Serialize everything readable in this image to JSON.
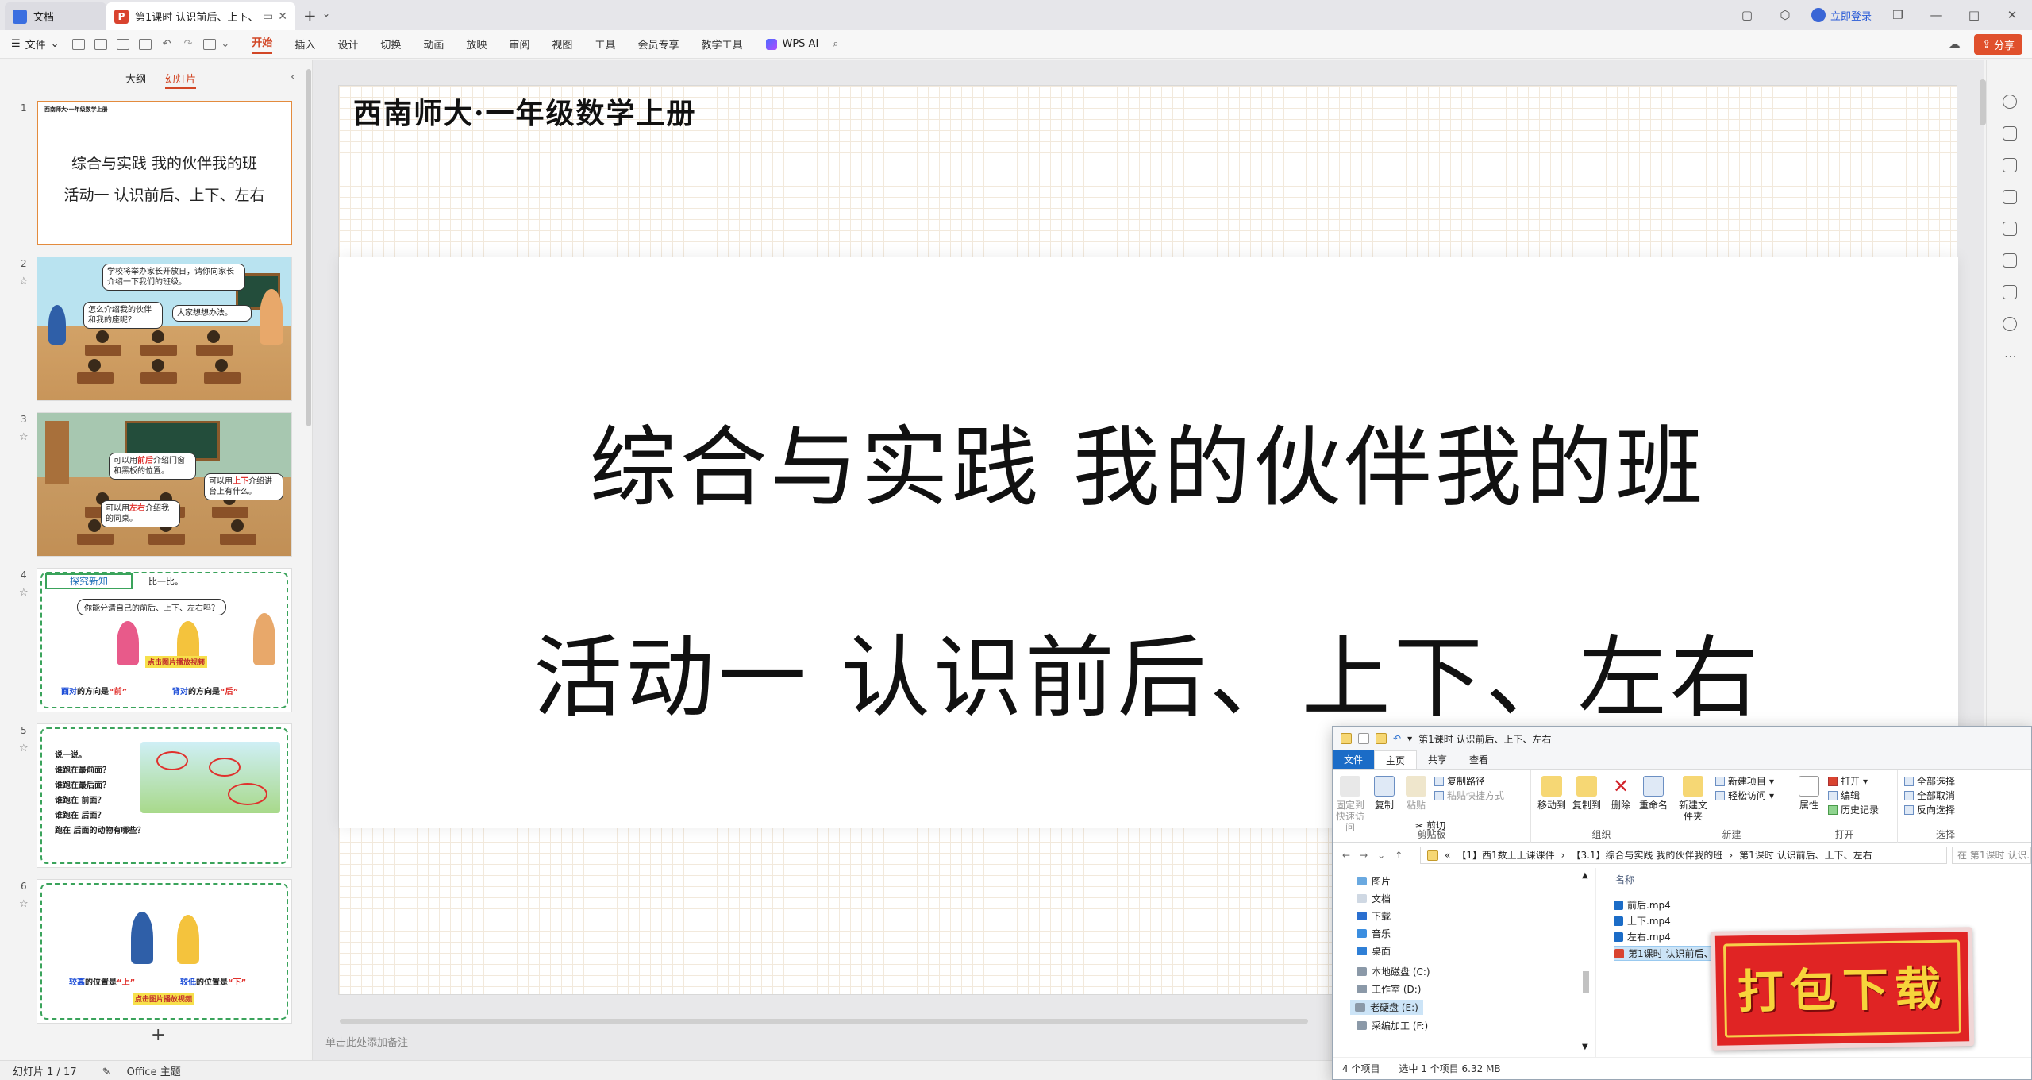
{
  "titlebar": {
    "tabs": [
      {
        "label": "文档"
      },
      {
        "label": "第1课时 认识前后、上下、左右"
      }
    ],
    "login": "立即登录"
  },
  "menubar": {
    "file": "文件",
    "items": [
      "开始",
      "插入",
      "设计",
      "切换",
      "动画",
      "放映",
      "审阅",
      "视图",
      "工具",
      "会员专享",
      "教学工具"
    ],
    "active": "开始",
    "ai": "WPS AI",
    "share": "分享"
  },
  "leftpanel": {
    "tabs": [
      "大纲",
      "幻灯片"
    ],
    "active_tab": "幻灯片",
    "thumbs": [
      {
        "num": "1",
        "small": "西南师大·一年级数学上册",
        "line1": "综合与实践  我的伙伴我的班",
        "line2": "活动一  认识前后、上下、左右"
      },
      {
        "num": "2",
        "b1": "学校将举办家长开放日，请你向家长介绍一下我们的班级。",
        "b2": "怎么介绍我的伙伴和我的座呢？",
        "b3": "大家想想办法。"
      },
      {
        "num": "3",
        "b1a": "可以用",
        "b1k": "前后",
        "b1b": "介绍门窗和黑板的位置。",
        "b2a": "可以用",
        "b2k": "上下",
        "b2b": "介绍讲台上有什么。",
        "b3a": "可以用",
        "b3k": "左右",
        "b3b": "介绍我的同桌。"
      },
      {
        "num": "4",
        "title": "探究新知",
        "badge": "比一比。",
        "q": "你能分清自己的前后、上下、左右吗？",
        "tag": "点击图片播放视频",
        "l1a": "面对",
        "l1b": "的方向是",
        "l1c": "“前”",
        "l2a": "背对",
        "l2b": "的方向是",
        "l2c": "“后”"
      },
      {
        "num": "5",
        "lines": [
          "说一说。",
          "谁跑在最前面？",
          "谁跑在最后面？",
          "谁跑在      前面？",
          "谁跑在      后面？",
          "跑在      后面的动物有哪些？"
        ]
      },
      {
        "num": "6",
        "l1a": "较高",
        "l1b": "的位置是",
        "l1c": "“上”",
        "l2a": "较低",
        "l2b": "的位置是",
        "l2c": "“下”",
        "tag": "点击图片播放视频"
      }
    ]
  },
  "slide": {
    "header": "西南师大·一年级数学上册",
    "title1": "综合与实践  我的伙伴我的班",
    "title2": "活动一  认识前后、上下、左右",
    "notes_placeholder": "单击此处添加备注"
  },
  "statusbar": {
    "slide_count": "幻灯片 1 / 17",
    "theme": "Office 主题"
  },
  "explorer": {
    "title": "第1课时 认识前后、上下、左右",
    "tabs": [
      "文件",
      "主页",
      "共享",
      "查看"
    ],
    "ribbon": {
      "clipboard": {
        "pin": "固定到快速访问",
        "copy": "复制",
        "paste": "粘贴",
        "copy_path": "复制路径",
        "paste_shortcut": "粘贴快捷方式",
        "cut": "剪切",
        "label": "剪贴板"
      },
      "organize": {
        "move": "移动到",
        "copyto": "复制到",
        "delete": "删除",
        "rename": "重命名",
        "label": "组织"
      },
      "new": {
        "folder": "新建文件夹",
        "item": "新建项目",
        "easy": "轻松访问",
        "label": "新建"
      },
      "open": {
        "props": "属性",
        "open": "打开",
        "edit": "编辑",
        "history": "历史记录",
        "label": "打开"
      },
      "select": {
        "all": "全部选择",
        "none": "全部取消",
        "invert": "反向选择",
        "label": "选择"
      }
    },
    "path": [
      "【1】西1数上上课课件",
      "【3.1】综合与实践 我的伙伴我的班",
      "第1课时 认识前后、上下、左右"
    ],
    "search_placeholder": "在 第1课时 认识...",
    "nav": [
      "图片",
      "文档",
      "下载",
      "音乐",
      "桌面",
      "本地磁盘 (C:)",
      "工作室 (D:)",
      "老硬盘 (E:)",
      "采编加工 (F:)"
    ],
    "column": "名称",
    "files": [
      "前后.mp4",
      "上下.mp4",
      "左右.mp4",
      "第1课时 认识前后、上..."
    ],
    "status": [
      "4 个项目",
      "选中 1 个项目  6.32 MB"
    ]
  },
  "badge": "打包下载"
}
